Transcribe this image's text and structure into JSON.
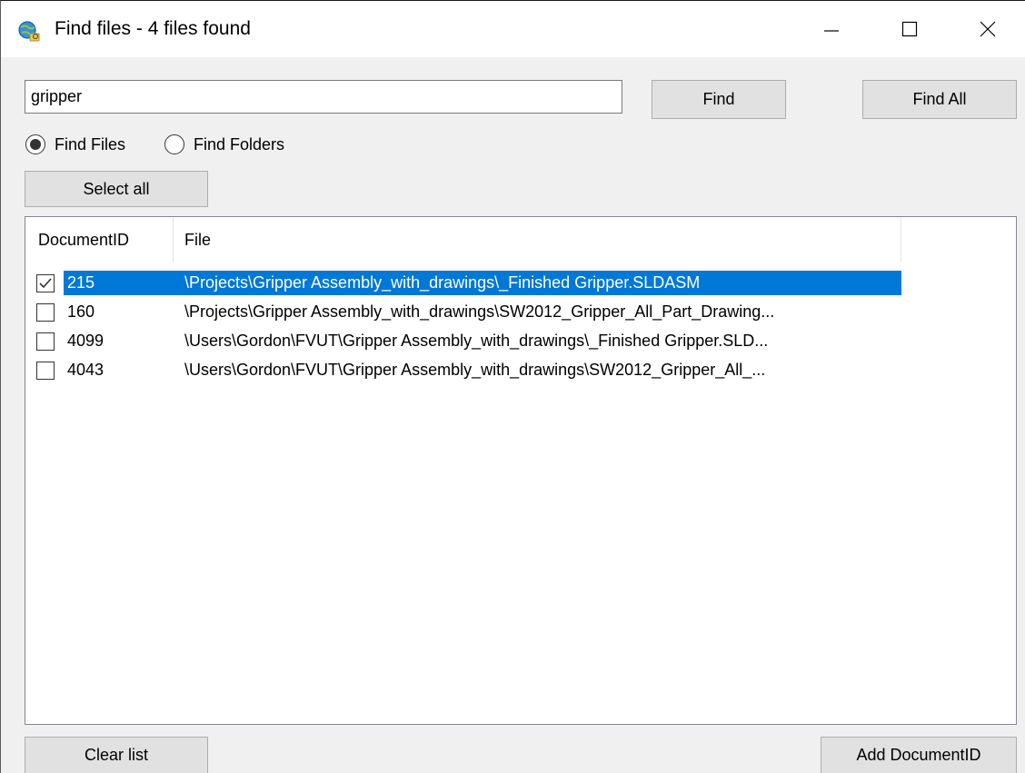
{
  "window": {
    "title": "Find files - 4 files found",
    "icon": "globe-search-icon"
  },
  "search": {
    "value": "gripper",
    "find_label": "Find",
    "find_all_label": "Find All"
  },
  "mode": {
    "options": [
      {
        "label": "Find Files",
        "selected": true
      },
      {
        "label": "Find Folders",
        "selected": false
      }
    ]
  },
  "select_all_label": "Select all",
  "results": {
    "columns": [
      "DocumentID",
      "File"
    ],
    "rows": [
      {
        "id": "215",
        "file": "\\Projects\\Gripper Assembly_with_drawings\\_Finished Gripper.SLDASM",
        "checked": true,
        "selected": true
      },
      {
        "id": "160",
        "file": "\\Projects\\Gripper Assembly_with_drawings\\SW2012_Gripper_All_Part_Drawing...",
        "checked": false,
        "selected": false
      },
      {
        "id": "4099",
        "file": "\\Users\\Gordon\\FVUT\\Gripper Assembly_with_drawings\\_Finished Gripper.SLD...",
        "checked": false,
        "selected": false
      },
      {
        "id": "4043",
        "file": "\\Users\\Gordon\\FVUT\\Gripper Assembly_with_drawings\\SW2012_Gripper_All_...",
        "checked": false,
        "selected": false
      }
    ]
  },
  "footer": {
    "clear_label": "Clear list",
    "add_label": "Add DocumentID"
  },
  "colors": {
    "selection": "#0078d7",
    "window_bg": "#f0f0f0",
    "button_bg": "#e1e1e1"
  }
}
